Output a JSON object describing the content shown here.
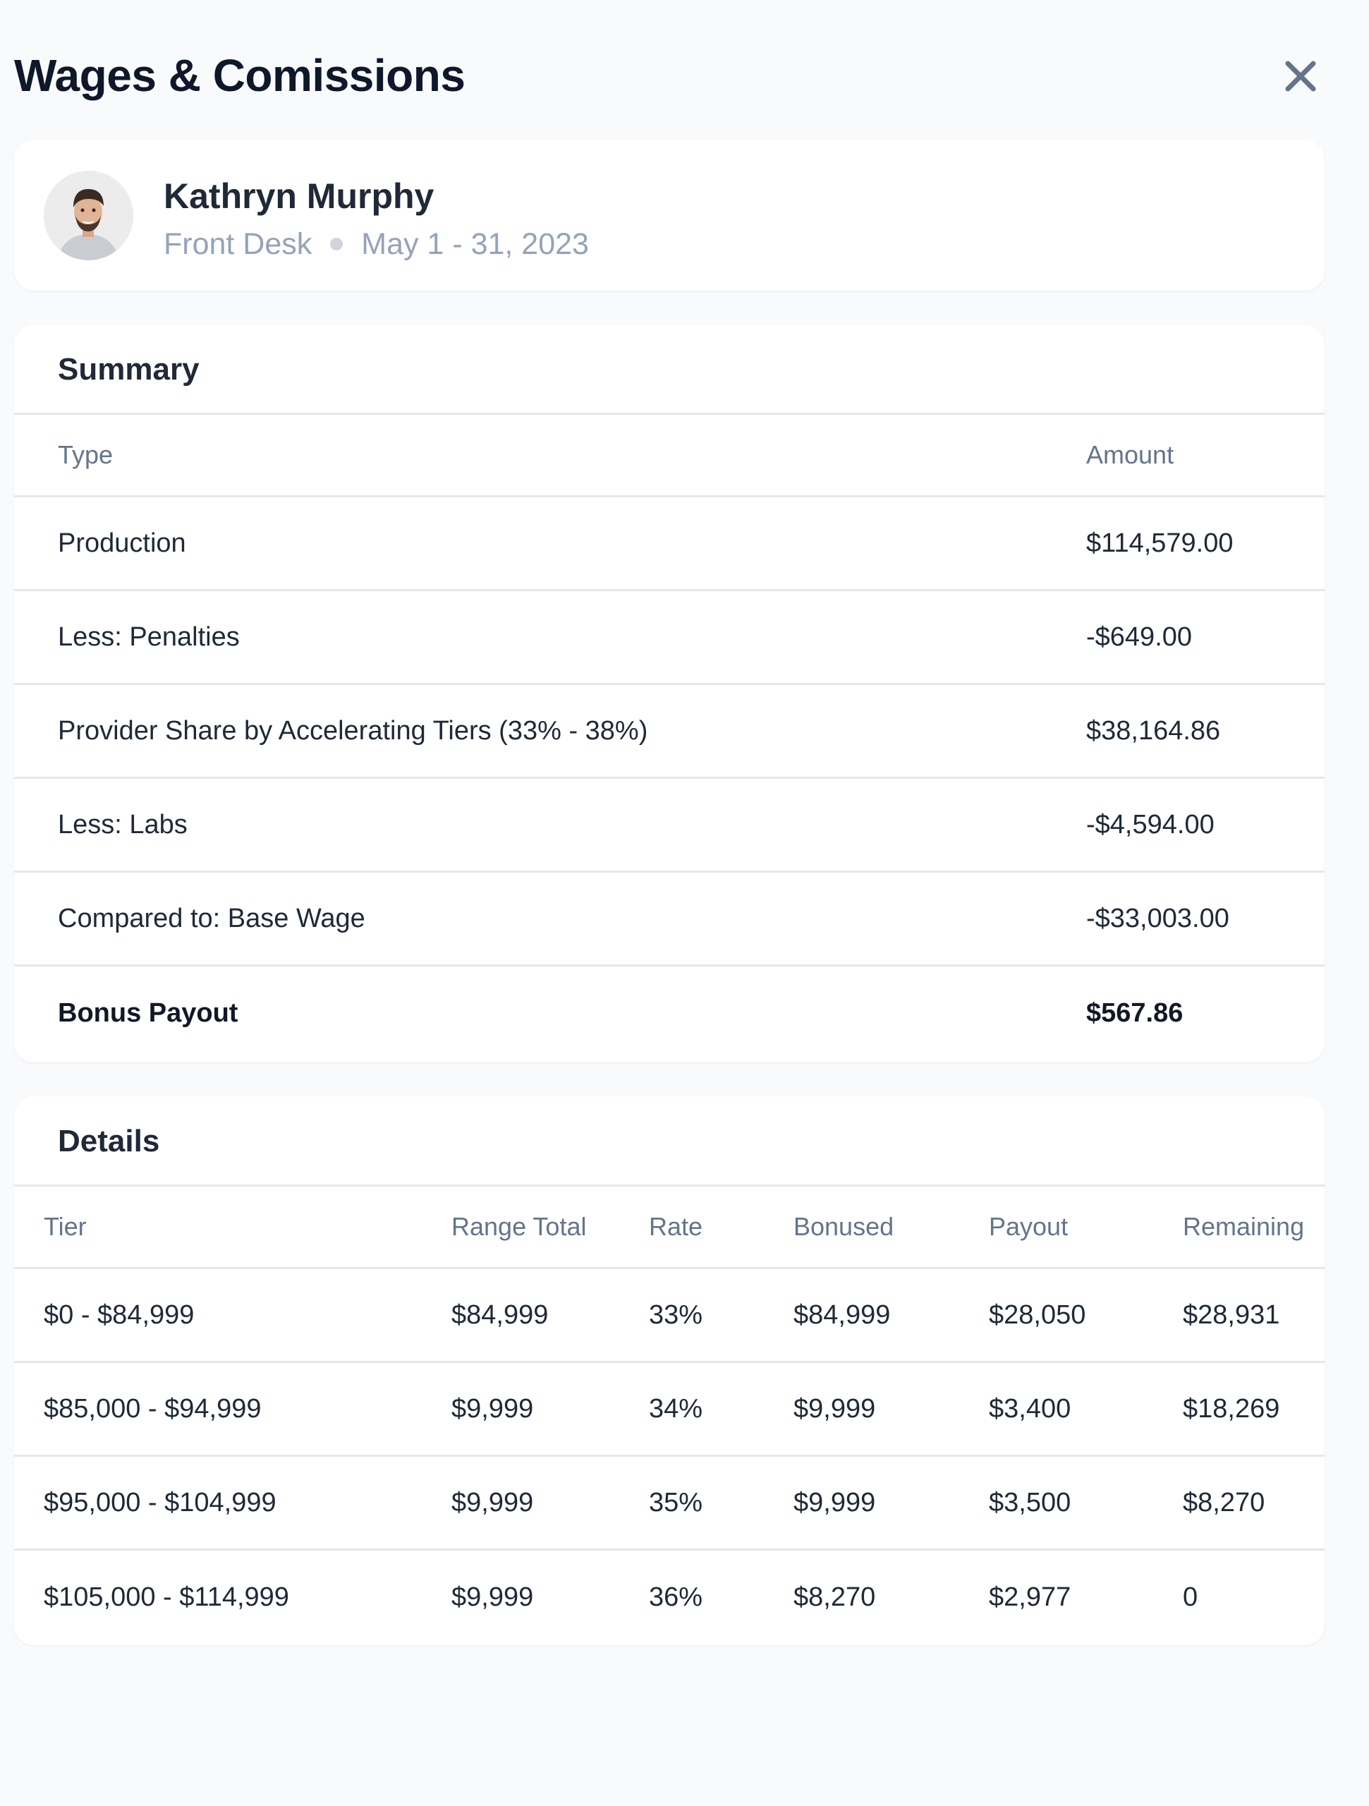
{
  "header": {
    "title": "Wages & Comissions"
  },
  "profile": {
    "name": "Kathryn Murphy",
    "role": "Front Desk",
    "period": "May 1 - 31, 2023"
  },
  "summary": {
    "title": "Summary",
    "columns": [
      "Type",
      "Amount"
    ],
    "rows": [
      {
        "type": "Production",
        "amount": "$114,579.00"
      },
      {
        "type": "Less: Penalties",
        "amount": "-$649.00"
      },
      {
        "type": "Provider Share by Accelerating Tiers (33% - 38%)",
        "amount": "$38,164.86"
      },
      {
        "type": "Less: Labs",
        "amount": "-$4,594.00"
      },
      {
        "type": "Compared to: Base Wage",
        "amount": "-$33,003.00"
      },
      {
        "type": "Bonus Payout",
        "amount": "$567.86"
      }
    ]
  },
  "details": {
    "title": "Details",
    "columns": [
      "Tier",
      "Range Total",
      "Rate",
      "Bonused",
      "Payout",
      "Remaining"
    ],
    "rows": [
      {
        "tier": "$0 - $84,999",
        "range_total": "$84,999",
        "rate": "33%",
        "bonused": "$84,999",
        "payout": "$28,050",
        "remaining": "$28,931"
      },
      {
        "tier": "$85,000 - $94,999",
        "range_total": "$9,999",
        "rate": "34%",
        "bonused": "$9,999",
        "payout": "$3,400",
        "remaining": "$18,269"
      },
      {
        "tier": "$95,000 - $104,999",
        "range_total": "$9,999",
        "rate": "35%",
        "bonused": "$9,999",
        "payout": "$3,500",
        "remaining": "$8,270"
      },
      {
        "tier": "$105,000 - $114,999",
        "range_total": "$9,999",
        "rate": "36%",
        "bonused": "$8,270",
        "payout": "$2,977",
        "remaining": "0"
      }
    ]
  },
  "colors": {
    "background": "#f8fafc",
    "card": "#ffffff",
    "text": "#1f2937",
    "muted": "#64748b",
    "divider": "#e5e7eb",
    "close_icon": "#64748b"
  },
  "icons": {
    "close": "close-icon",
    "avatar": "avatar-photo"
  }
}
